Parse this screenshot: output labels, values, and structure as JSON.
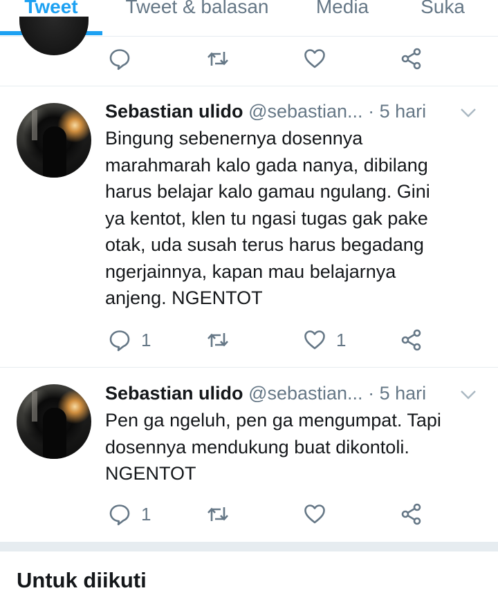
{
  "tabs": [
    "Tweet",
    "Tweet & balasan",
    "Media",
    "Suka"
  ],
  "tweets": [
    {
      "name": "Sebastian ulido",
      "handle": "@sebastian...",
      "separator": "·",
      "time": "5 hari",
      "text": "Bingung sebenernya dosennya\nmarahmarah kalo gada nanya, dibilang\nharus belajar kalo gamau ngulang. Gini\nya kentot, klen tu ngasi tugas gak pake\notak, uda susah terus harus begadang\nngerjainnya, kapan mau belajarnya\nanjeng. NGENTOT",
      "reply_count": "1",
      "like_count": "1"
    },
    {
      "name": "Sebastian ulido",
      "handle": "@sebastian...",
      "separator": "·",
      "time": "5 hari",
      "text": "Pen ga ngeluh, pen ga mengumpat. Tapi\ndosennya mendukung buat dikontoli.\nNGENTOT",
      "reply_count": "1",
      "like_count": ""
    }
  ],
  "section": {
    "title": "Untuk diikuti"
  },
  "colors": {
    "accent": "#1da1f2",
    "muted": "#657786",
    "text": "#14171a",
    "divider": "#e6ecf0"
  },
  "icons": [
    "reply-icon",
    "retweet-icon",
    "like-icon",
    "share-icon",
    "chevron-down-icon"
  ]
}
